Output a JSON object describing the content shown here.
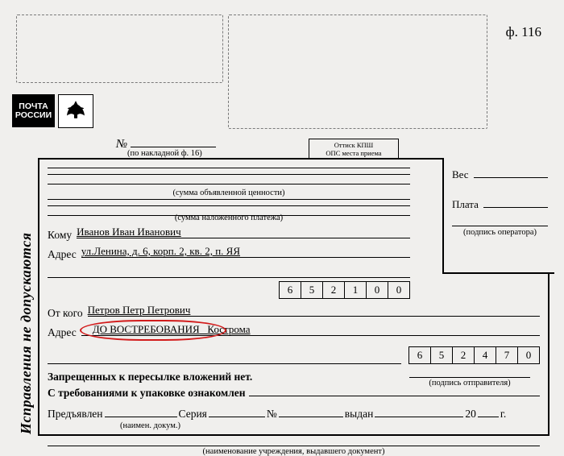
{
  "form_number": "ф. 116",
  "logo": {
    "line1": "ПОЧТА",
    "line2": "РОССИИ"
  },
  "doc_number": {
    "label": "№",
    "sub": "(по накладной ф. 16)"
  },
  "stamp": {
    "line1": "Оттиск КПШ",
    "line2": "ОПС места приема"
  },
  "vertical_warning": "Исправления не допускаются",
  "declared_value": {
    "caption": "(сумма объявленной ценности)"
  },
  "cod_value": {
    "caption": "(сумма наложенного платежа)"
  },
  "recipient": {
    "label_to": "Кому",
    "name": "Иванов Иван Иванович",
    "label_addr": "Адрес",
    "address": "ул.Ленина, д. 6, корп. 2, кв. 2, п. ЯЯ",
    "index": [
      "6",
      "5",
      "2",
      "1",
      "0",
      "0"
    ]
  },
  "sender": {
    "label_from": "От кого",
    "name": "Петров Петр Петрович",
    "label_addr": "Адрес",
    "address_highlight": "ДО ВОСТРЕБОВАНИЯ",
    "address_tail": "Кострома",
    "index": [
      "6",
      "5",
      "2",
      "4",
      "7",
      "0"
    ]
  },
  "notch": {
    "weight_label": "Вес",
    "fee_label": "Плата",
    "operator_caption": "(подпись оператора)"
  },
  "statements": {
    "line1": "Запрещенных к пересылке вложений нет.",
    "line2": "С требованиями к упаковке ознакомлен",
    "sender_sig_caption": "(подпись отправителя)"
  },
  "id_doc": {
    "presented": "Предъявлен",
    "presented_sub": "(наимен. докум.)",
    "series": "Серия",
    "no": "№",
    "issued": "выдан",
    "year_suffix": "г.",
    "year_prefix": "20",
    "issuer_caption": "(наименование учреждения, выдавшего документ)"
  }
}
